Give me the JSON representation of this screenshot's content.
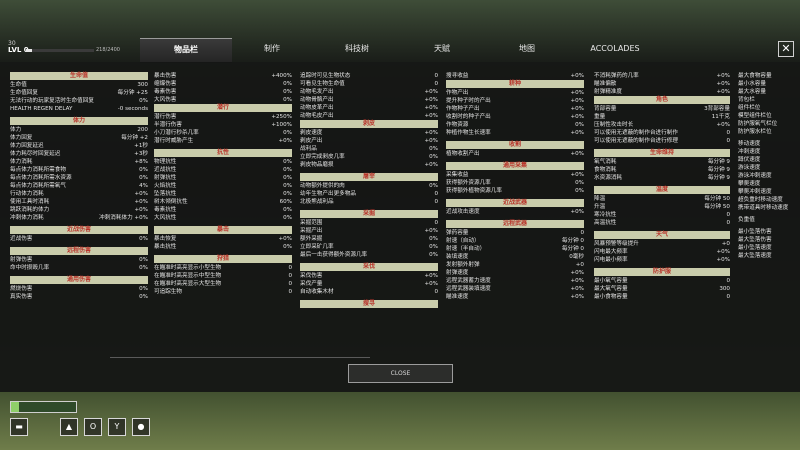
{
  "header": {
    "level_small": "30",
    "level_label": "LVL 0",
    "xp_text": "218/2400",
    "xp_progress": 0.09,
    "tabs": [
      {
        "label": "物品栏",
        "active": true
      },
      {
        "label": "制作",
        "active": false
      },
      {
        "label": "科技树",
        "active": false
      },
      {
        "label": "天赋",
        "active": false
      },
      {
        "label": "地图",
        "active": false
      },
      {
        "label": "ACCOLADES",
        "active": false
      }
    ],
    "close_icon": "close-x-icon"
  },
  "columns": [
    {
      "sections": [
        {
          "title": "生命值",
          "rows": [
            {
              "l": "生命值",
              "v": "300"
            },
            {
              "l": "生命值回复",
              "v": "每分钟 +25"
            },
            {
              "l": "无法行动的玩家复活时生命值回复",
              "v": "0%"
            },
            {
              "l": "HEALTH REGEN DELAY",
              "v": "-0 seconds"
            }
          ]
        },
        {
          "title": "体力",
          "rows": [
            {
              "l": "体力",
              "v": "200"
            },
            {
              "l": "体力回复",
              "v": "每分钟 +2"
            },
            {
              "l": "体力回复延迟",
              "v": "+1秒"
            },
            {
              "l": "体力耗尽时回复延迟",
              "v": "+3秒"
            },
            {
              "l": "体力消耗",
              "v": "+8%"
            },
            {
              "l": "每点体力消耗所需食物",
              "v": "0%"
            },
            {
              "l": "每点体力消耗所需水资源",
              "v": "0%"
            },
            {
              "l": "每点体力消耗所需氧气",
              "v": "4%"
            },
            {
              "l": "行动体力消耗",
              "v": "+0%"
            },
            {
              "l": "使用工具时消耗",
              "v": "+0%"
            },
            {
              "l": "跳跃消耗的体力",
              "v": "+0%"
            },
            {
              "l": "冲刺体力消耗",
              "v": "冲刺消耗体力 +0%"
            }
          ]
        },
        {
          "title": "近战伤害",
          "rows": [
            {
              "l": "近战伤害",
              "v": "0%"
            }
          ]
        },
        {
          "title": "远程伤害",
          "rows": [
            {
              "l": "射弹伤害",
              "v": "0%"
            },
            {
              "l": "命中时损毁几率",
              "v": "0%"
            }
          ]
        },
        {
          "title": "通用伤害",
          "rows": [
            {
              "l": "燃烧伤害",
              "v": "0%"
            },
            {
              "l": "真实伤害",
              "v": "0%"
            }
          ]
        }
      ]
    },
    {
      "sections": [
        {
          "title": "",
          "rows": [
            {
              "l": "暴击伤害",
              "v": "+400%"
            },
            {
              "l": "缩爆伤害",
              "v": "0%"
            },
            {
              "l": "毒素伤害",
              "v": "0%"
            },
            {
              "l": "大风伤害",
              "v": "0%"
            }
          ]
        },
        {
          "title": "潜行",
          "rows": [
            {
              "l": "潜行伤害",
              "v": "+250%"
            },
            {
              "l": "半潜行伤害",
              "v": "+100%"
            },
            {
              "l": "小刀潜行秒杀几率",
              "v": "0%"
            },
            {
              "l": "潜行时威胁产生",
              "v": "+0%"
            }
          ]
        },
        {
          "title": "抗性",
          "rows": [
            {
              "l": "物理抗性",
              "v": "0%"
            },
            {
              "l": "近战抗性",
              "v": "0%"
            },
            {
              "l": "射弹抗性",
              "v": "0%"
            },
            {
              "l": "火焰抗性",
              "v": "0%"
            },
            {
              "l": "坠落抗性",
              "v": "0%"
            },
            {
              "l": "树木倾倒抗性",
              "v": "60%"
            },
            {
              "l": "毒素抗性",
              "v": "0%"
            },
            {
              "l": "大风抗性",
              "v": "0%"
            }
          ]
        },
        {
          "title": "暴击",
          "rows": [
            {
              "l": "暴击恢复",
              "v": "+0%"
            },
            {
              "l": "暴击抗性",
              "v": "0%"
            }
          ]
        },
        {
          "title": "狩猎",
          "rows": [
            {
              "l": "在瞄准时高亮显示小型生物",
              "v": "0"
            },
            {
              "l": "在瞄准时高亮显示中型生物",
              "v": "0"
            },
            {
              "l": "在瞄准时高亮显示大型生物",
              "v": "0"
            },
            {
              "l": "可追踪生物",
              "v": "0"
            }
          ]
        }
      ]
    },
    {
      "sections": [
        {
          "title": "",
          "rows": [
            {
              "l": "追踪时可见生物状态",
              "v": "0"
            },
            {
              "l": "可看见生物生命值",
              "v": "0"
            },
            {
              "l": "动物毛发产出",
              "v": "+0%"
            },
            {
              "l": "动物骨骼产出",
              "v": "+0%"
            },
            {
              "l": "动物皮革产出",
              "v": "+0%"
            },
            {
              "l": "动物毛皮产出",
              "v": "+0%"
            }
          ]
        },
        {
          "title": "剥皮",
          "rows": [
            {
              "l": "剥皮速度",
              "v": "+0%"
            },
            {
              "l": "剥皮产出",
              "v": "+0%"
            },
            {
              "l": "战利品",
              "v": "0%"
            },
            {
              "l": "立即完成剥皮几率",
              "v": "0%"
            },
            {
              "l": "剥皮物品磨损",
              "v": "+0%"
            }
          ]
        },
        {
          "title": "屠宰",
          "rows": [
            {
              "l": "动物额外提供的肉",
              "v": "0%"
            },
            {
              "l": "幼年生物产出更多物品",
              "v": "0"
            },
            {
              "l": "北极熊战利品",
              "v": "0"
            }
          ]
        },
        {
          "title": "采掘",
          "rows": [
            {
              "l": "采掘范围",
              "v": "0"
            },
            {
              "l": "采掘产出",
              "v": "+0%"
            },
            {
              "l": "额外采掘",
              "v": "0%"
            },
            {
              "l": "立即采矿几率",
              "v": "0%"
            },
            {
              "l": "最后一击获得额外资源几率",
              "v": "0%"
            }
          ]
        },
        {
          "title": "采伐",
          "rows": [
            {
              "l": "采伐伤害",
              "v": "+0%"
            },
            {
              "l": "采伐产量",
              "v": "+0%"
            },
            {
              "l": "自动收集木材",
              "v": "0"
            }
          ]
        },
        {
          "title": "搜寻",
          "rows": []
        }
      ]
    },
    {
      "sections": [
        {
          "title": "",
          "rows": [
            {
              "l": "搜寻收益",
              "v": "+0%"
            }
          ]
        },
        {
          "title": "耕种",
          "rows": [
            {
              "l": "作物产出",
              "v": "+0%"
            },
            {
              "l": "提升种子时的产出",
              "v": "+0%"
            },
            {
              "l": "作物种子产出",
              "v": "+0%"
            },
            {
              "l": "收割时的种子产出",
              "v": "+0%"
            },
            {
              "l": "作物资源",
              "v": "0%"
            },
            {
              "l": "种植作物生长速率",
              "v": "+0%"
            }
          ]
        },
        {
          "title": "收割",
          "rows": [
            {
              "l": "植物收割产出",
              "v": "+0%"
            }
          ]
        },
        {
          "title": "通用采集",
          "rows": [
            {
              "l": "采集收益",
              "v": "+0%"
            },
            {
              "l": "获得额外资源几率",
              "v": "0%"
            },
            {
              "l": "获得额外植物资源几率",
              "v": "0%"
            }
          ]
        },
        {
          "title": "近战武器",
          "rows": [
            {
              "l": "近战攻击速度",
              "v": "+0%"
            }
          ]
        },
        {
          "title": "远程武器",
          "rows": [
            {
              "l": "弹药容量",
              "v": "0"
            },
            {
              "l": "射速（自动）",
              "v": "每分钟 0"
            },
            {
              "l": "射速（半自动）",
              "v": "每分钟 0"
            },
            {
              "l": "装填速度",
              "v": "0毫秒"
            },
            {
              "l": "发射额外射弹",
              "v": "+0"
            },
            {
              "l": "射弹速度",
              "v": "+0%"
            },
            {
              "l": "远程武器蓄力速度",
              "v": "+0%"
            },
            {
              "l": "远程武器装填速度",
              "v": "+0%"
            },
            {
              "l": "瞄准速度",
              "v": "+0%"
            }
          ]
        }
      ]
    },
    {
      "sections": [
        {
          "title": "",
          "rows": [
            {
              "l": "不消耗弹药的几率",
              "v": "+0%"
            },
            {
              "l": "瞄准偏散",
              "v": "+0%"
            },
            {
              "l": "射弹精准度",
              "v": "+0%"
            }
          ]
        },
        {
          "title": "角色",
          "rows": [
            {
              "l": "背部容量",
              "v": "3背部容量"
            },
            {
              "l": "重量",
              "v": "11千克"
            },
            {
              "l": "压制性攻击时长",
              "v": "+0%"
            },
            {
              "l": "可以使用无遮蔽的制作台进行制作",
              "v": "0"
            },
            {
              "l": "可以使用无遮蔽的制作台进行修理",
              "v": "0"
            }
          ]
        },
        {
          "title": "生命维持",
          "rows": [
            {
              "l": "氧气消耗",
              "v": "每分钟 9"
            },
            {
              "l": "食物消耗",
              "v": "每分钟 9"
            },
            {
              "l": "水资源消耗",
              "v": "每分钟 9"
            }
          ]
        },
        {
          "title": "温度",
          "rows": [
            {
              "l": "降温",
              "v": "每分钟 50"
            },
            {
              "l": "升温",
              "v": "每分钟 50"
            },
            {
              "l": "寒冷抗性",
              "v": "0"
            },
            {
              "l": "高温抗性",
              "v": "0"
            }
          ]
        },
        {
          "title": "天气",
          "rows": [
            {
              "l": "风暴预警等级提升",
              "v": "+0"
            },
            {
              "l": "闪电最大频率",
              "v": "+0%"
            },
            {
              "l": "闪电最小频率",
              "v": "+0%"
            }
          ]
        },
        {
          "title": "防护服",
          "rows": [
            {
              "l": "最小氧气容量",
              "v": "0"
            },
            {
              "l": "最大氧气容量",
              "v": "300"
            },
            {
              "l": "最小食物容量",
              "v": "0"
            }
          ]
        }
      ]
    },
    {
      "sections": [
        {
          "title": "",
          "rows": [
            {
              "l": "最大食物容量",
              "v": ""
            },
            {
              "l": "最小水容量",
              "v": ""
            },
            {
              "l": "最大水容量",
              "v": ""
            },
            {
              "l": "背包栏",
              "v": ""
            },
            {
              "l": "组件栏位",
              "v": ""
            },
            {
              "l": "模型组件栏位",
              "v": ""
            },
            {
              "l": "防护服氧气栏位",
              "v": ""
            },
            {
              "l": "防护服水栏位",
              "v": ""
            }
          ]
        },
        {
          "title": "",
          "rows": [
            {
              "l": "移动速度",
              "v": ""
            },
            {
              "l": "冲刺速度",
              "v": ""
            },
            {
              "l": "蹲伏速度",
              "v": ""
            },
            {
              "l": "游泳速度",
              "v": ""
            },
            {
              "l": "游泳冲刺速度",
              "v": ""
            },
            {
              "l": "攀爬速度",
              "v": ""
            },
            {
              "l": "攀爬冲刺速度",
              "v": ""
            },
            {
              "l": "超负重时移动速度",
              "v": ""
            },
            {
              "l": "携带道具时移动速度",
              "v": ""
            }
          ]
        },
        {
          "title": "",
          "rows": [
            {
              "l": "负重值",
              "v": ""
            }
          ]
        },
        {
          "title": "",
          "rows": [
            {
              "l": "最小坠落伤害",
              "v": ""
            },
            {
              "l": "最大坠落伤害",
              "v": ""
            },
            {
              "l": "最小坠落速度",
              "v": ""
            },
            {
              "l": "最大坠落速度",
              "v": ""
            }
          ]
        }
      ]
    }
  ],
  "footer": {
    "close_label": "CLOSE"
  },
  "hud": {
    "health_progress": 0.12,
    "icons": [
      "thermometer-icon",
      "flame-icon",
      "oxygen-icon",
      "food-icon",
      "water-icon"
    ]
  }
}
